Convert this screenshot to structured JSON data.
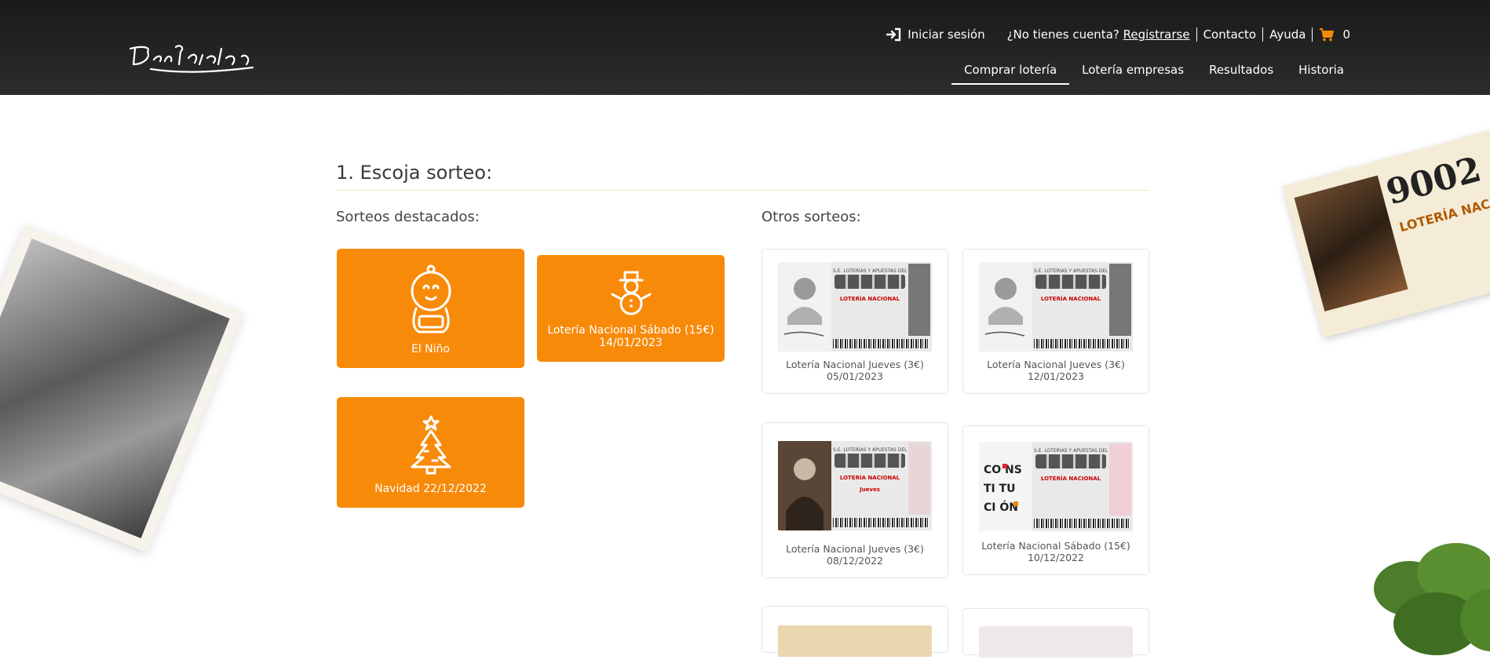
{
  "header": {
    "logo_alt": "Doña Manolita",
    "login": "Iniciar sesión",
    "no_account": "¿No tienes cuenta?",
    "register": "Registrarse",
    "contact": "Contacto",
    "help": "Ayuda",
    "cart_count": "0",
    "nav": [
      "Comprar lotería",
      "Lotería empresas",
      "Resultados",
      "Historia"
    ]
  },
  "main": {
    "title": "1. Escoja sorteo:",
    "featured_label": "Sorteos destacados:",
    "other_label": "Otros sorteos:",
    "featured": [
      {
        "icon": "baby-icon",
        "line1": "El Niño",
        "line2": ""
      },
      {
        "icon": "snowman-icon",
        "line1": "Lotería Nacional Sábado (15€)",
        "line2": "14/01/2023"
      },
      {
        "icon": "christmas-tree-icon",
        "line1": "Navidad 22/12/2022",
        "line2": ""
      }
    ],
    "others": [
      {
        "line1": "Lotería Nacional Jueves (3€)",
        "line2": "05/01/2023",
        "ticket_label": "LOTERÍA NACIONAL"
      },
      {
        "line1": "Lotería Nacional Jueves (3€)",
        "line2": "12/01/2023",
        "ticket_label": "LOTERÍA NACIONAL"
      },
      {
        "line1": "Lotería Nacional Jueves (3€)",
        "line2": "08/12/2022",
        "ticket_label": "LOTERÍA NACIONAL Jueves"
      },
      {
        "line1": "Lotería Nacional Sábado (15€)",
        "line2": "10/12/2022",
        "ticket_label": "LOTERÍA NACIONAL"
      }
    ]
  },
  "colors": {
    "accent": "#f88a0a",
    "header_bg": "#222222"
  },
  "decor": {
    "right_ticket_number": "9002",
    "right_ticket_text": "LOTERÍA NACIO"
  }
}
